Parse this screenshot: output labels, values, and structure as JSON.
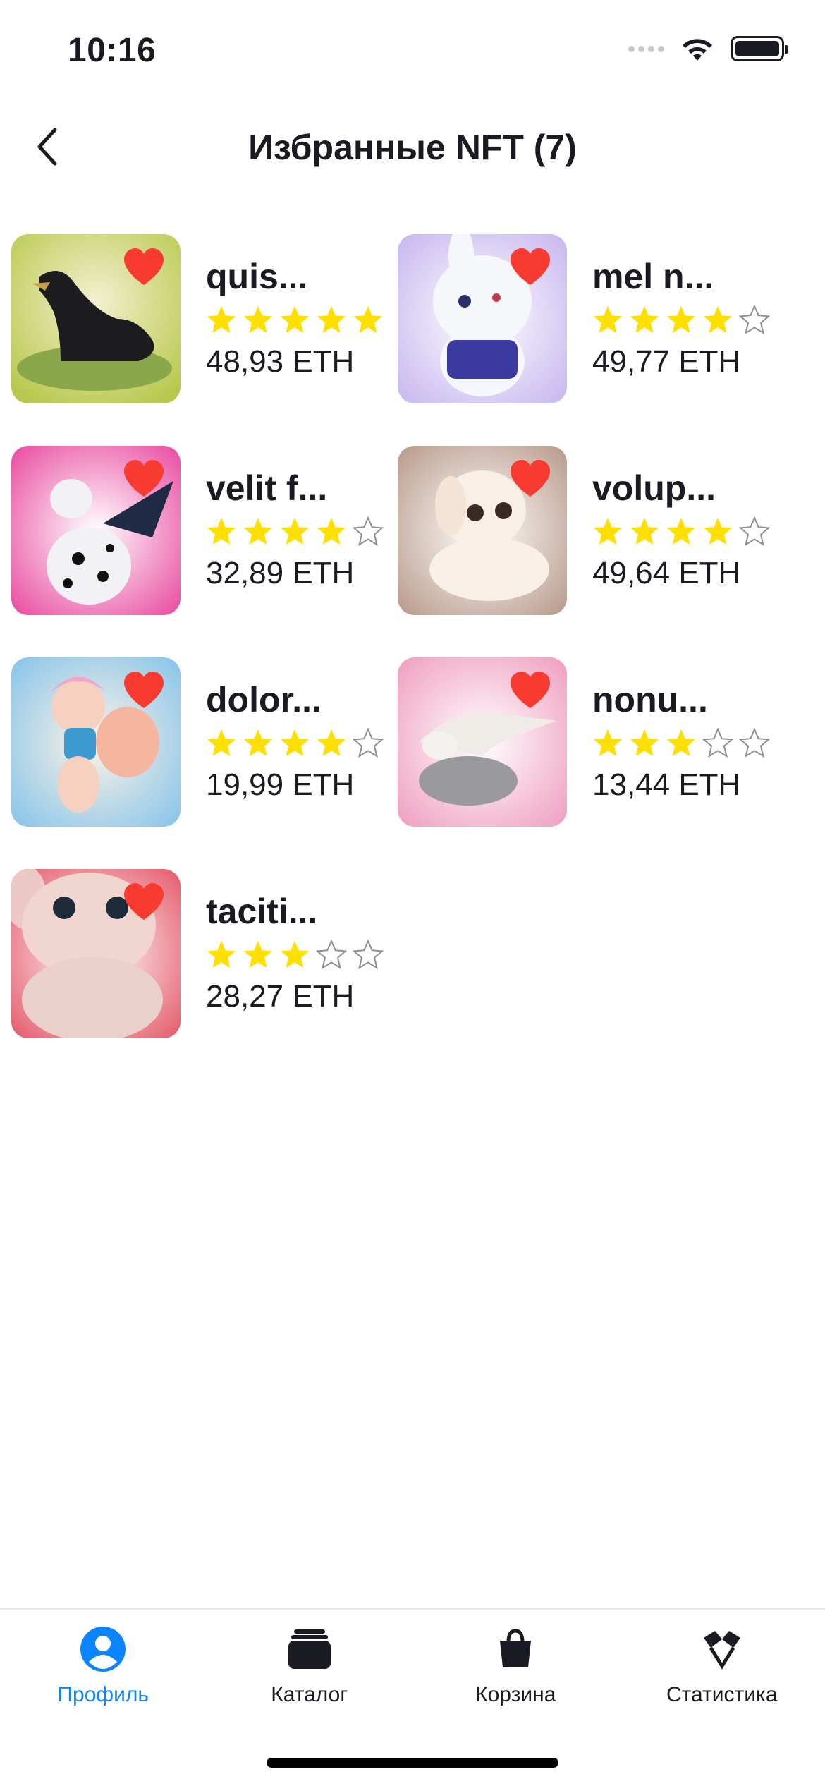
{
  "status_bar": {
    "time": "10:16"
  },
  "nav": {
    "title": "Избранные NFT (7)"
  },
  "colors": {
    "accent": "#0a84ff",
    "star_on": "#fee000",
    "star_off": "#8e8e93",
    "like": "#f73b30"
  },
  "items": [
    {
      "name": "quis...",
      "rating": 5,
      "price": "48,93 ETH",
      "art": "dark-creature"
    },
    {
      "name": "mel n...",
      "rating": 4,
      "price": "49,77 ETH",
      "art": "white-bunny"
    },
    {
      "name": "velit f...",
      "rating": 4,
      "price": "32,89 ETH",
      "art": "spotted-unicorn"
    },
    {
      "name": "volup...",
      "rating": 4,
      "price": "49,64 ETH",
      "art": "white-puppy"
    },
    {
      "name": "dolor...",
      "rating": 4,
      "price": "19,99 ETH",
      "art": "pink-fairy"
    },
    {
      "name": "nonu...",
      "rating": 3,
      "price": "13,44 ETH",
      "art": "white-dragon"
    },
    {
      "name": "taciti...",
      "rating": 3,
      "price": "28,27 ETH",
      "art": "pink-baby"
    }
  ],
  "tabbar": {
    "tabs": [
      {
        "label": "Профиль",
        "icon": "profile-icon",
        "active": true
      },
      {
        "label": "Каталог",
        "icon": "catalog-icon",
        "active": false
      },
      {
        "label": "Корзина",
        "icon": "cart-icon",
        "active": false
      },
      {
        "label": "Статистика",
        "icon": "statistics-icon",
        "active": false
      }
    ]
  }
}
